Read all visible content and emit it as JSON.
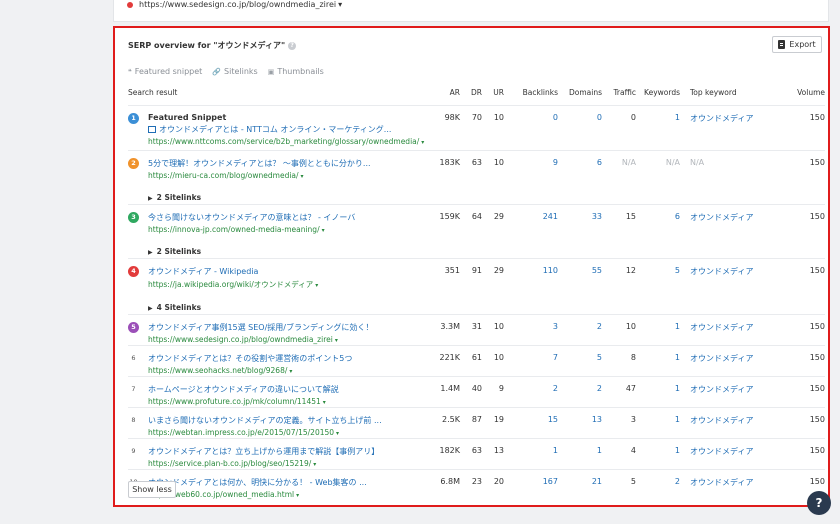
{
  "top_card": {
    "url": "https://www.sedesign.co.jp/blog/owndmedia_zirei",
    "caret": "▾"
  },
  "serp": {
    "title": "SERP overview for \"オウンドメディア\"",
    "help": "?",
    "export_label": "Export",
    "features": [
      {
        "icon": "featured-snippet-icon",
        "glyph": "❝",
        "label": "Featured snippet"
      },
      {
        "icon": "sitelinks-icon",
        "glyph": "🔗",
        "label": "Sitelinks"
      },
      {
        "icon": "thumbnails-icon",
        "glyph": "▣",
        "label": "Thumbnails"
      }
    ],
    "columns": [
      "Search result",
      "AR",
      "DR",
      "UR",
      "Backlinks",
      "Domains",
      "Traffic",
      "Keywords",
      "Top keyword",
      "Volume"
    ],
    "rows": [
      {
        "rank": "1",
        "rank_color": "#3b8fd6",
        "featured_label": "Featured Snippet",
        "title": "オウンドメディアとは - NTTコム オンライン・マーケティング...",
        "url": "https://www.nttcoms.com/service/b2b_marketing/glossary/ownedmedia/",
        "ar": "98K",
        "dr": "70",
        "ur": "10",
        "backlinks": "0",
        "domains": "0",
        "traffic": "0",
        "keywords": "1",
        "top_keyword": "オウンドメディア",
        "volume": "150"
      },
      {
        "rank": "2",
        "rank_color": "#f0922b",
        "title": "5分で理解！オウンドメディアとは？ ～事例とともに分かり...",
        "url": "https://mieru-ca.com/blog/ownedmedia/",
        "sitelinks": "2 Sitelinks",
        "ar": "183K",
        "dr": "63",
        "ur": "10",
        "backlinks": "9",
        "domains": "6",
        "traffic": "N/A",
        "keywords": "N/A",
        "top_keyword": "N/A",
        "volume": "150"
      },
      {
        "rank": "3",
        "rank_color": "#2fa860",
        "title": "今さら聞けないオウンドメディアの意味とは？ - イノーバ",
        "url": "https://innova-jp.com/owned-media-meaning/",
        "sitelinks": "2 Sitelinks",
        "ar": "159K",
        "dr": "64",
        "ur": "29",
        "backlinks": "241",
        "domains": "33",
        "traffic": "15",
        "keywords": "6",
        "top_keyword": "オウンドメディア",
        "volume": "150"
      },
      {
        "rank": "4",
        "rank_color": "#e23b3b",
        "title": "オウンドメディア - Wikipedia",
        "url": "https://ja.wikipedia.org/wiki/オウンドメディア",
        "sitelinks": "4 Sitelinks",
        "ar": "351",
        "dr": "91",
        "ur": "29",
        "backlinks": "110",
        "domains": "55",
        "traffic": "12",
        "keywords": "5",
        "top_keyword": "オウンドメディア",
        "volume": "150"
      },
      {
        "rank": "5",
        "rank_color": "#9b4fb8",
        "title": "オウンドメディア事例15選 SEO/採用/ブランディングに効く！",
        "url": "https://www.sedesign.co.jp/blog/owndmedia_zirei",
        "ar": "3.3M",
        "dr": "31",
        "ur": "10",
        "backlinks": "3",
        "domains": "2",
        "traffic": "10",
        "keywords": "1",
        "top_keyword": "オウンドメディア",
        "volume": "150"
      },
      {
        "rank": "6",
        "title": "オウンドメディアとは？その役割や運営術のポイント5つ",
        "url": "https://www.seohacks.net/blog/9268/",
        "ar": "221K",
        "dr": "61",
        "ur": "10",
        "backlinks": "7",
        "domains": "5",
        "traffic": "8",
        "keywords": "1",
        "top_keyword": "オウンドメディア",
        "volume": "150"
      },
      {
        "rank": "7",
        "title": "ホームページとオウンドメディアの違いについて解説",
        "url": "https://www.profuture.co.jp/mk/column/11451",
        "ar": "1.4M",
        "dr": "40",
        "ur": "9",
        "backlinks": "2",
        "domains": "2",
        "traffic": "47",
        "keywords": "1",
        "top_keyword": "オウンドメディア",
        "volume": "150"
      },
      {
        "rank": "8",
        "title": "いまさら聞けないオウンドメディアの定義。サイト立ち上げ前 ...",
        "url": "https://webtan.impress.co.jp/e/2015/07/15/20150",
        "ar": "2.5K",
        "dr": "87",
        "ur": "19",
        "backlinks": "15",
        "domains": "13",
        "traffic": "3",
        "keywords": "1",
        "top_keyword": "オウンドメディア",
        "volume": "150"
      },
      {
        "rank": "9",
        "title": "オウンドメディアとは？立ち上げから運用まで解説【事例アリ】",
        "url": "https://service.plan-b.co.jp/blog/seo/15219/",
        "ar": "182K",
        "dr": "63",
        "ur": "13",
        "backlinks": "1",
        "domains": "1",
        "traffic": "4",
        "keywords": "1",
        "top_keyword": "オウンドメディア",
        "volume": "150"
      },
      {
        "rank": "10",
        "title": "オウンドメディアとは何か、明快に分かる！ - Web集客の ...",
        "url": "https://web60.co.jp/owned_media.html",
        "ar": "6.8M",
        "dr": "23",
        "ur": "20",
        "backlinks": "167",
        "domains": "21",
        "traffic": "5",
        "keywords": "2",
        "top_keyword": "オウンドメディア",
        "volume": "150"
      }
    ],
    "show_less": "Show less"
  },
  "help_fab": "?"
}
